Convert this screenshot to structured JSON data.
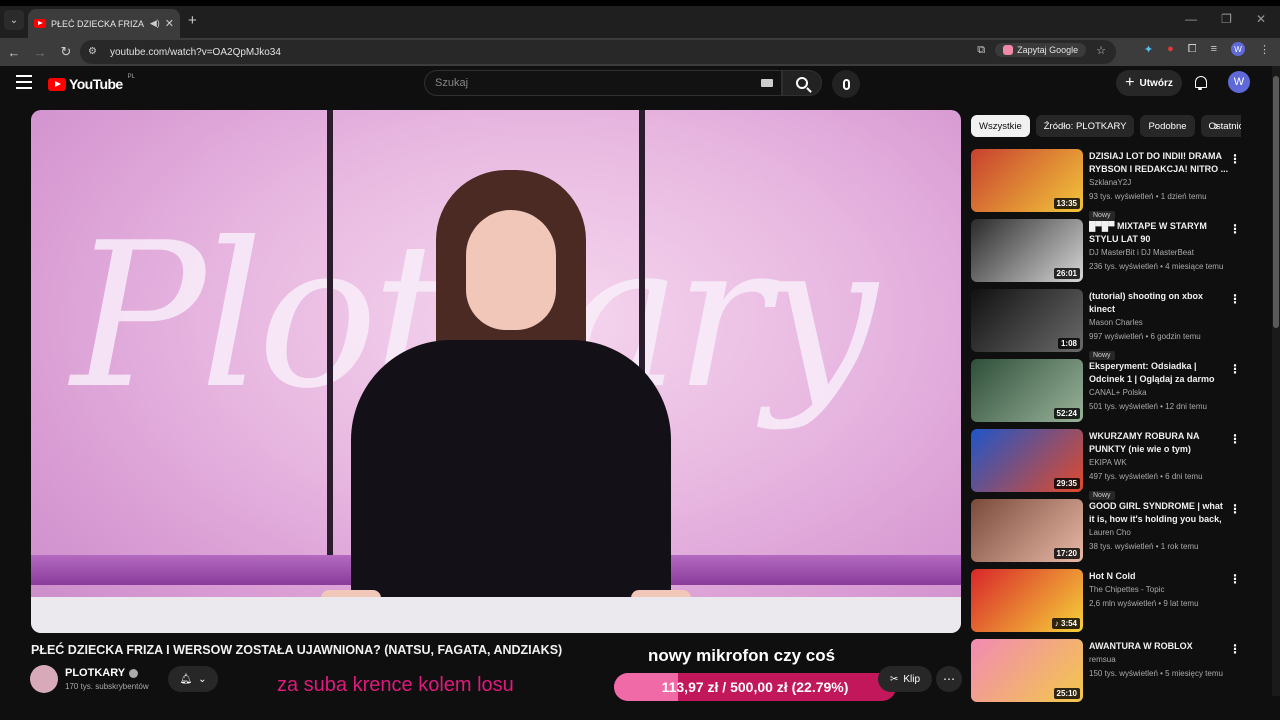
{
  "browser": {
    "tab_title": "PŁEĆ DZIECKA FRIZA I WERSOW",
    "new_tab_glyph": "+",
    "url": "youtube.com/watch?v=OA2QpMJko34",
    "ask_google": "Zapytaj Google",
    "profile_initial": "W"
  },
  "header": {
    "logo_text": "YouTube",
    "region": "PL",
    "search_placeholder": "Szukaj",
    "create_label": "Utwórz",
    "avatar_initial": "W"
  },
  "video": {
    "brand_text": "Plotkary",
    "title": "PŁEĆ DZIECKA FRIZA I WERSOW ZOSTAŁA UJAWNIONA? (NATSU, FAGATA, ANDZIAKS)",
    "channel": "PLOTKARY",
    "subscribers": "170 tys. subskrybentów",
    "clip_label": "Klip",
    "overlay_pink": "za suba krence kolem losu",
    "overlay_white": "nowy mikrofon czy coś",
    "goal_text": "113,97 zł / 500,00 zł (22.79%)",
    "goal_fraction": 0.2279
  },
  "chips": [
    "Wszystkie",
    "Źródło: PLOTKARY",
    "Podobne",
    "Ostatnio przesłane"
  ],
  "recommendations": [
    {
      "title": "DZISIAJ LOT DO INDII! DRAMA RYBSON I REDAKCJA! NITRO ...",
      "channel": "SzklanaY2J",
      "meta": "93 tys. wyświetleń • 1 dzień temu",
      "badge": "Nowy",
      "duration": "13:35",
      "thumb_color": "#c8402f",
      "thumb_color2": "#f2c63a"
    },
    {
      "title": "█▀█▀ MIXTAPE W STARYM STYLU LAT 90",
      "channel": "DJ MasterBit i DJ MasterBeat",
      "meta": "236 tys. wyświetleń • 4 miesiące temu",
      "badge": "",
      "duration": "26:01",
      "thumb_color": "#2a2a2a",
      "thumb_color2": "#d8d8d8"
    },
    {
      "title": "(tutorial) shooting on xbox kinect",
      "channel": "Mason Charles",
      "meta": "997 wyświetleń • 6 godzin temu",
      "badge": "Nowy",
      "duration": "1:08",
      "thumb_color": "#111111",
      "thumb_color2": "#6a6a6a"
    },
    {
      "title": "Eksperyment: Odsiadka | Odcinek 1 | Oglądaj za darmo",
      "channel": "CANAL+ Polska",
      "meta": "501 tys. wyświetleń • 12 dni temu",
      "badge": "",
      "duration": "52:24",
      "thumb_color": "#2f4f3a",
      "thumb_color2": "#9ab39a"
    },
    {
      "title": "WKURZAMY ROBURA NA PUNKTY (nie wie o tym)",
      "channel": "EKIPA WK",
      "meta": "497 tys. wyświetleń • 6 dni temu",
      "badge": "Nowy",
      "duration": "29:35",
      "thumb_color": "#1e56c8",
      "thumb_color2": "#e24a2a"
    },
    {
      "title": "GOOD GIRL SYNDROME | what it is, how it's holding you back, ...",
      "channel": "Lauren Cho",
      "meta": "38 tys. wyświetleń • 1 rok temu",
      "badge": "",
      "duration": "17:20",
      "thumb_color": "#7a4a3a",
      "thumb_color2": "#e9b9a8"
    },
    {
      "title": "Hot N Cold",
      "channel": "The Chipettes - Topic",
      "meta": "2,6 mln wyświetleń • 9 lat temu",
      "badge": "",
      "duration": "♪ 3:54",
      "thumb_color": "#d8262a",
      "thumb_color2": "#f7d23a"
    },
    {
      "title": "AWANTURA W ROBLOX",
      "channel": "remsua",
      "meta": "150 tys. wyświetleń • 5 miesięcy temu",
      "badge": "",
      "duration": "25:10",
      "thumb_color": "#f28ab4",
      "thumb_color2": "#f2c84a"
    }
  ]
}
